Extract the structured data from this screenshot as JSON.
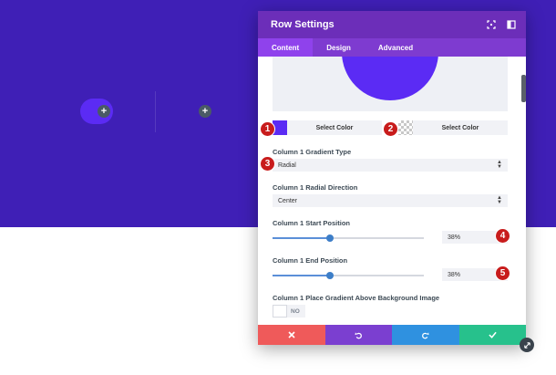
{
  "modal": {
    "title": "Row Settings",
    "tabs": [
      {
        "label": "Content",
        "active": true
      },
      {
        "label": "Design",
        "active": false
      },
      {
        "label": "Advanced",
        "active": false
      }
    ]
  },
  "colors": {
    "canvas_bg": "#3f1fb6",
    "header_bg": "#6c2eb9",
    "tabs_bg": "#7e3bd0",
    "gradient_color": "#5b2bf4",
    "cancel": "#ef5a5a",
    "undo": "#7b3fd0",
    "redo": "#2f91e0",
    "save": "#27c18c",
    "badge": "#c81c1c"
  },
  "color_pickers": {
    "start_label": "Select Color",
    "end_label": "Select Color"
  },
  "gradient_type": {
    "label": "Column 1 Gradient Type",
    "value": "Radial"
  },
  "radial_direction": {
    "label": "Column 1 Radial Direction",
    "value": "Center"
  },
  "start_position": {
    "label": "Column 1 Start Position",
    "value": "38%",
    "fraction": 0.38
  },
  "end_position": {
    "label": "Column 1 End Position",
    "value": "38%",
    "fraction": 0.38
  },
  "place_above": {
    "label": "Column 1 Place Gradient Above Background Image",
    "toggle_text": "NO"
  },
  "badges": [
    "1",
    "2",
    "3",
    "4",
    "5"
  ],
  "footer_icons": [
    "close-icon",
    "undo-icon",
    "redo-icon",
    "check-icon"
  ],
  "plus_symbol": "+"
}
